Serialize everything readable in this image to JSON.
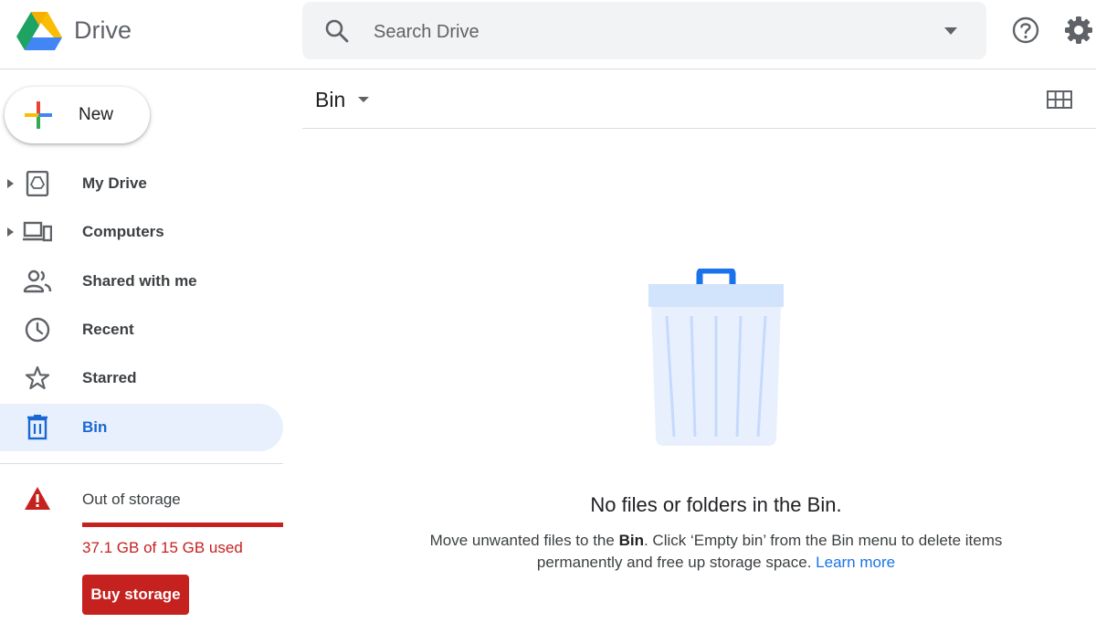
{
  "header": {
    "app_name": "Drive",
    "search_placeholder": "Search Drive"
  },
  "sidebar": {
    "new_label": "New",
    "items": [
      {
        "label": "My Drive",
        "icon": "my-drive-icon",
        "expandable": true
      },
      {
        "label": "Computers",
        "icon": "computers-icon",
        "expandable": true
      },
      {
        "label": "Shared with me",
        "icon": "shared-icon",
        "expandable": false
      },
      {
        "label": "Recent",
        "icon": "clock-icon",
        "expandable": false
      },
      {
        "label": "Starred",
        "icon": "star-icon",
        "expandable": false
      },
      {
        "label": "Bin",
        "icon": "bin-icon",
        "expandable": false,
        "active": true
      }
    ],
    "storage": {
      "title": "Out of storage",
      "usage_text": "37.1 GB of 15 GB used",
      "used_fraction": 1.0,
      "buy_label": "Buy storage"
    }
  },
  "main": {
    "title": "Bin",
    "empty_state": {
      "title": "No files or folders in the Bin.",
      "desc_part1": "Move unwanted files to the ",
      "desc_bold": "Bin",
      "desc_part2": ". Click ‘Empty bin’ from the Bin menu to delete items",
      "desc_line2": "permanently and free up storage space.",
      "learn_more": "Learn more"
    }
  },
  "colors": {
    "accent_blue": "#1a73e8",
    "active_bg": "#e8f0fe",
    "warning_red": "#c5221f",
    "bin_light": "#e8f0fe",
    "bin_lid": "#d2e3fc"
  }
}
